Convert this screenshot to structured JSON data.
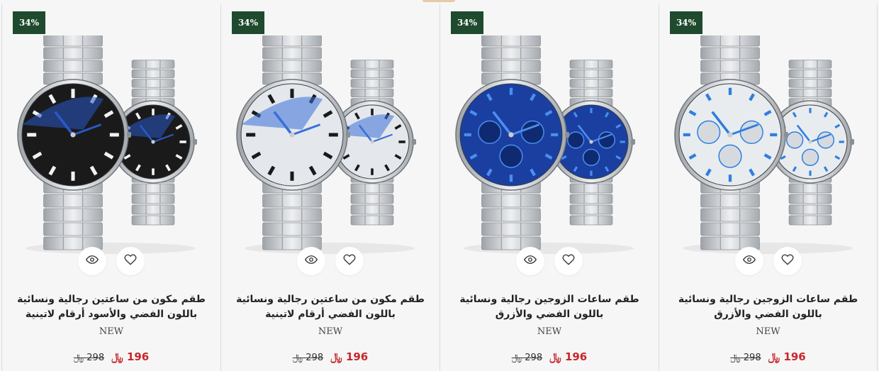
{
  "products": [
    {
      "discount_badge": "34%",
      "title": "طقم ساعات الزوجين رجالية ونسائية باللون الفضي والأزرق",
      "tag": "NEW",
      "price_new": "196 ﷼",
      "price_old": "298 ﷼",
      "dial_style": "white-blue-chrono",
      "dial_color": "#e8ecef",
      "accent_color": "#2f7fe0"
    },
    {
      "discount_badge": "34%",
      "title": "طقم ساعات الزوجين رجالية ونسائية باللون الفضي والأزرق",
      "tag": "NEW",
      "price_new": "196 ﷼",
      "price_old": "298 ﷼",
      "dial_style": "blue-chrono",
      "dial_color": "#1a3fa0",
      "accent_color": "#4a8ef0"
    },
    {
      "discount_badge": "34%",
      "title": "طقم مكون من ساعتين رجالية ونسائية باللون الفضي أرقام لاتينية",
      "tag": "NEW",
      "price_new": "196 ﷼",
      "price_old": "298 ﷼",
      "dial_style": "silver-roman",
      "dial_color": "#e4e8ec",
      "accent_color": "#3a6fd8"
    },
    {
      "discount_badge": "34%",
      "title": "طقم مكون من ساعتين رجالية ونسائية باللون الفضي والأسود أرقام لاتينية",
      "tag": "NEW",
      "price_new": "196 ﷼",
      "price_old": "298 ﷼",
      "dial_style": "black-roman",
      "dial_color": "#1a1a1a",
      "accent_color": "#2a58c8"
    }
  ],
  "icons": {
    "quick_view": "eye-icon",
    "wishlist": "heart-icon"
  },
  "colors": {
    "badge_bg": "#1f4a2e",
    "price_new": "#c8262c",
    "page_bg": "#f6f6f6"
  }
}
